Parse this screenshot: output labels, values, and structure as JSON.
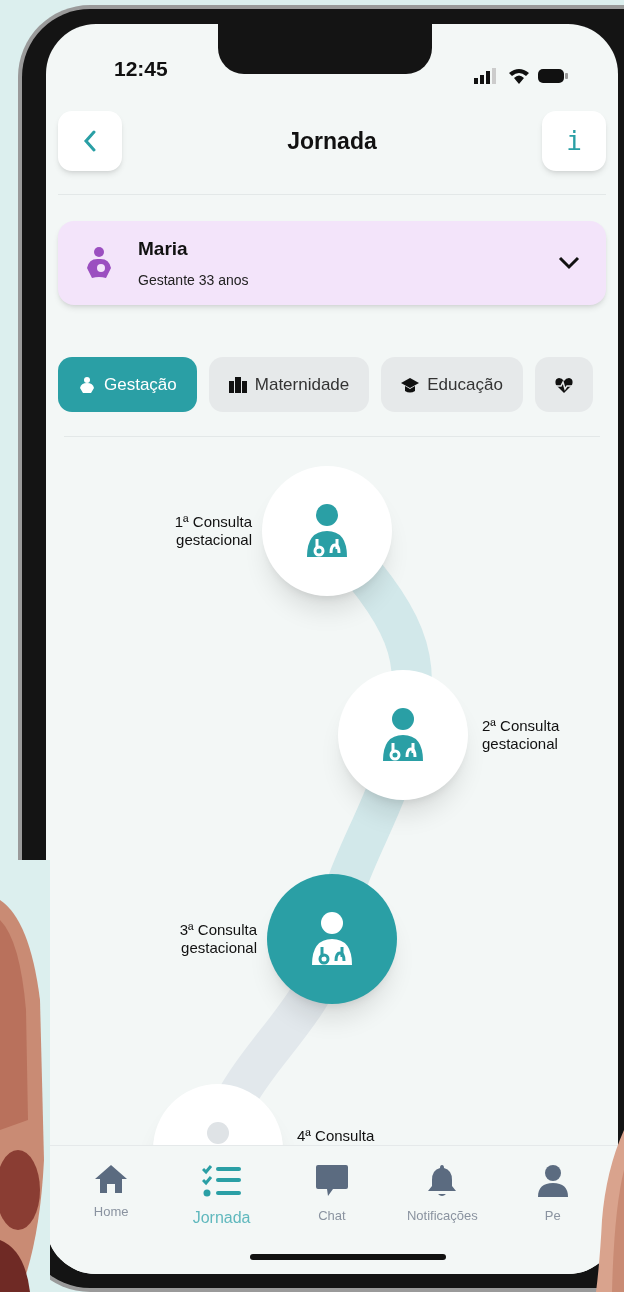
{
  "status_bar": {
    "time": "12:45"
  },
  "header": {
    "title": "Jornada",
    "info_button": "i"
  },
  "profile": {
    "name": "Maria",
    "subtitle": "Gestante 33 anos"
  },
  "tabs": [
    {
      "label": "Gestação",
      "selected": true
    },
    {
      "label": "Maternidade",
      "selected": false
    },
    {
      "label": "Educação",
      "selected": false
    },
    {
      "selected": false
    }
  ],
  "journey": [
    {
      "label": "1ª Consulta gestacional",
      "selected": false,
      "disabled": false
    },
    {
      "label": "2ª Consulta gestacional",
      "selected": false,
      "disabled": false
    },
    {
      "label": "3ª Consulta gestacional",
      "selected": true,
      "disabled": false
    },
    {
      "label": "4ª Consulta",
      "selected": false,
      "disabled": true
    }
  ],
  "nav": [
    {
      "label": "Home",
      "selected": false
    },
    {
      "label": "Jornada",
      "selected": true
    },
    {
      "label": "Chat",
      "selected": false
    },
    {
      "label": "Notificações",
      "selected": false
    },
    {
      "label": "Pe",
      "selected": false
    }
  ]
}
